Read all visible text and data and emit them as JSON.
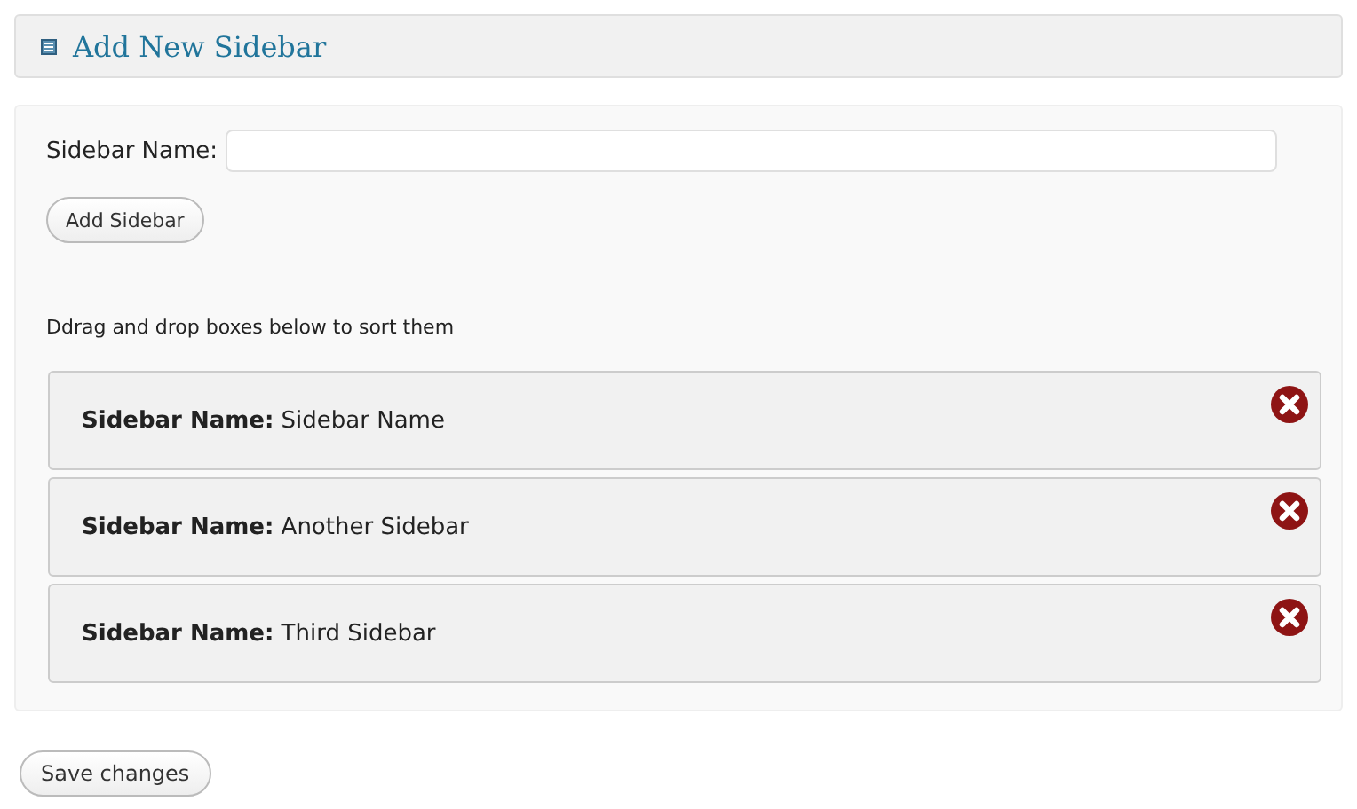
{
  "header": {
    "title": "Add New Sidebar"
  },
  "form": {
    "label": "Sidebar Name:",
    "button": "Add Sidebar"
  },
  "hint": "Ddrag and drop boxes below to sort them",
  "sidebars": [
    {
      "text": "**Sidebar Name:** Sidebar Name"
    },
    {
      "text": "**Sidebar Name:** Another Sidebar"
    },
    {
      "text": "**Sidebar Name:** Third Sidebar"
    }
  ],
  "save_button": "Save changes"
}
